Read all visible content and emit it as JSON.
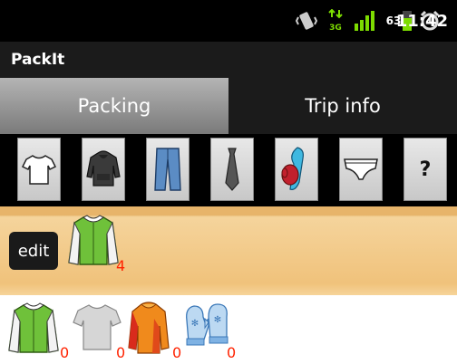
{
  "statusbar": {
    "network": "3G",
    "battery": "63",
    "time": "11:42"
  },
  "app": {
    "title": "PackIt"
  },
  "tabs": [
    {
      "label": "Packing",
      "active": true
    },
    {
      "label": "Trip info",
      "active": false
    }
  ],
  "categories": [
    {
      "name": "t-shirt",
      "icon": "tshirt-icon"
    },
    {
      "name": "hoodie",
      "icon": "hoodie-icon"
    },
    {
      "name": "pants",
      "icon": "pants-icon"
    },
    {
      "name": "tie",
      "icon": "tie-icon"
    },
    {
      "name": "winter gear",
      "icon": "scarf-mitten-icon"
    },
    {
      "name": "underwear",
      "icon": "underwear-icon"
    },
    {
      "name": "other",
      "label": "?"
    }
  ],
  "shelf": {
    "edit_label": "edit",
    "packed": [
      {
        "icon": "varsity-jacket-icon",
        "count": "4"
      }
    ]
  },
  "items": [
    {
      "icon": "varsity-jacket-icon",
      "count": "0"
    },
    {
      "icon": "grey-tshirt-icon",
      "count": "0"
    },
    {
      "icon": "orange-jacket-icon",
      "count": "0"
    },
    {
      "icon": "blue-mittens-icon",
      "count": "0"
    }
  ]
}
